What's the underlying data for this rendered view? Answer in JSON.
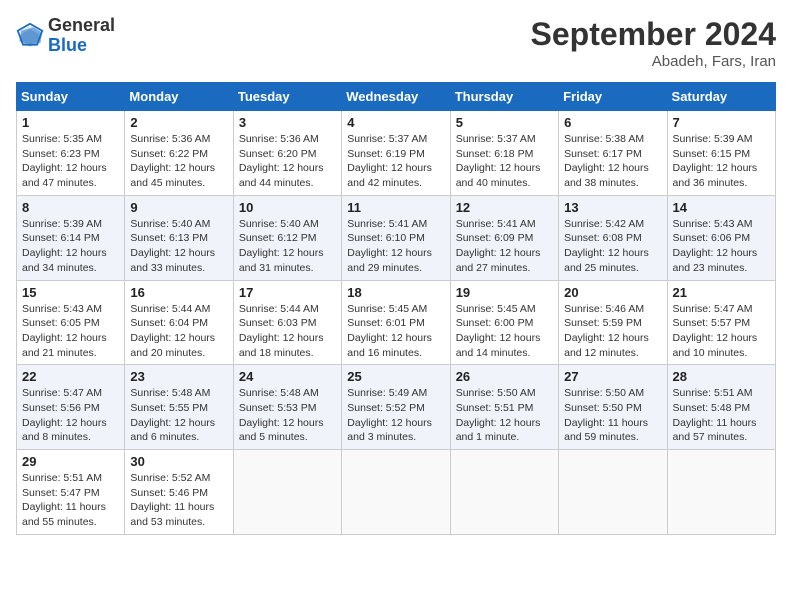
{
  "header": {
    "logo_general": "General",
    "logo_blue": "Blue",
    "month": "September 2024",
    "location": "Abadeh, Fars, Iran"
  },
  "days_of_week": [
    "Sunday",
    "Monday",
    "Tuesday",
    "Wednesday",
    "Thursday",
    "Friday",
    "Saturday"
  ],
  "weeks": [
    [
      {
        "day": 1,
        "info": "Sunrise: 5:35 AM\nSunset: 6:23 PM\nDaylight: 12 hours\nand 47 minutes."
      },
      {
        "day": 2,
        "info": "Sunrise: 5:36 AM\nSunset: 6:22 PM\nDaylight: 12 hours\nand 45 minutes."
      },
      {
        "day": 3,
        "info": "Sunrise: 5:36 AM\nSunset: 6:20 PM\nDaylight: 12 hours\nand 44 minutes."
      },
      {
        "day": 4,
        "info": "Sunrise: 5:37 AM\nSunset: 6:19 PM\nDaylight: 12 hours\nand 42 minutes."
      },
      {
        "day": 5,
        "info": "Sunrise: 5:37 AM\nSunset: 6:18 PM\nDaylight: 12 hours\nand 40 minutes."
      },
      {
        "day": 6,
        "info": "Sunrise: 5:38 AM\nSunset: 6:17 PM\nDaylight: 12 hours\nand 38 minutes."
      },
      {
        "day": 7,
        "info": "Sunrise: 5:39 AM\nSunset: 6:15 PM\nDaylight: 12 hours\nand 36 minutes."
      }
    ],
    [
      {
        "day": 8,
        "info": "Sunrise: 5:39 AM\nSunset: 6:14 PM\nDaylight: 12 hours\nand 34 minutes."
      },
      {
        "day": 9,
        "info": "Sunrise: 5:40 AM\nSunset: 6:13 PM\nDaylight: 12 hours\nand 33 minutes."
      },
      {
        "day": 10,
        "info": "Sunrise: 5:40 AM\nSunset: 6:12 PM\nDaylight: 12 hours\nand 31 minutes."
      },
      {
        "day": 11,
        "info": "Sunrise: 5:41 AM\nSunset: 6:10 PM\nDaylight: 12 hours\nand 29 minutes."
      },
      {
        "day": 12,
        "info": "Sunrise: 5:41 AM\nSunset: 6:09 PM\nDaylight: 12 hours\nand 27 minutes."
      },
      {
        "day": 13,
        "info": "Sunrise: 5:42 AM\nSunset: 6:08 PM\nDaylight: 12 hours\nand 25 minutes."
      },
      {
        "day": 14,
        "info": "Sunrise: 5:43 AM\nSunset: 6:06 PM\nDaylight: 12 hours\nand 23 minutes."
      }
    ],
    [
      {
        "day": 15,
        "info": "Sunrise: 5:43 AM\nSunset: 6:05 PM\nDaylight: 12 hours\nand 21 minutes."
      },
      {
        "day": 16,
        "info": "Sunrise: 5:44 AM\nSunset: 6:04 PM\nDaylight: 12 hours\nand 20 minutes."
      },
      {
        "day": 17,
        "info": "Sunrise: 5:44 AM\nSunset: 6:03 PM\nDaylight: 12 hours\nand 18 minutes."
      },
      {
        "day": 18,
        "info": "Sunrise: 5:45 AM\nSunset: 6:01 PM\nDaylight: 12 hours\nand 16 minutes."
      },
      {
        "day": 19,
        "info": "Sunrise: 5:45 AM\nSunset: 6:00 PM\nDaylight: 12 hours\nand 14 minutes."
      },
      {
        "day": 20,
        "info": "Sunrise: 5:46 AM\nSunset: 5:59 PM\nDaylight: 12 hours\nand 12 minutes."
      },
      {
        "day": 21,
        "info": "Sunrise: 5:47 AM\nSunset: 5:57 PM\nDaylight: 12 hours\nand 10 minutes."
      }
    ],
    [
      {
        "day": 22,
        "info": "Sunrise: 5:47 AM\nSunset: 5:56 PM\nDaylight: 12 hours\nand 8 minutes."
      },
      {
        "day": 23,
        "info": "Sunrise: 5:48 AM\nSunset: 5:55 PM\nDaylight: 12 hours\nand 6 minutes."
      },
      {
        "day": 24,
        "info": "Sunrise: 5:48 AM\nSunset: 5:53 PM\nDaylight: 12 hours\nand 5 minutes."
      },
      {
        "day": 25,
        "info": "Sunrise: 5:49 AM\nSunset: 5:52 PM\nDaylight: 12 hours\nand 3 minutes."
      },
      {
        "day": 26,
        "info": "Sunrise: 5:50 AM\nSunset: 5:51 PM\nDaylight: 12 hours\nand 1 minute."
      },
      {
        "day": 27,
        "info": "Sunrise: 5:50 AM\nSunset: 5:50 PM\nDaylight: 11 hours\nand 59 minutes."
      },
      {
        "day": 28,
        "info": "Sunrise: 5:51 AM\nSunset: 5:48 PM\nDaylight: 11 hours\nand 57 minutes."
      }
    ],
    [
      {
        "day": 29,
        "info": "Sunrise: 5:51 AM\nSunset: 5:47 PM\nDaylight: 11 hours\nand 55 minutes."
      },
      {
        "day": 30,
        "info": "Sunrise: 5:52 AM\nSunset: 5:46 PM\nDaylight: 11 hours\nand 53 minutes."
      },
      null,
      null,
      null,
      null,
      null
    ]
  ]
}
